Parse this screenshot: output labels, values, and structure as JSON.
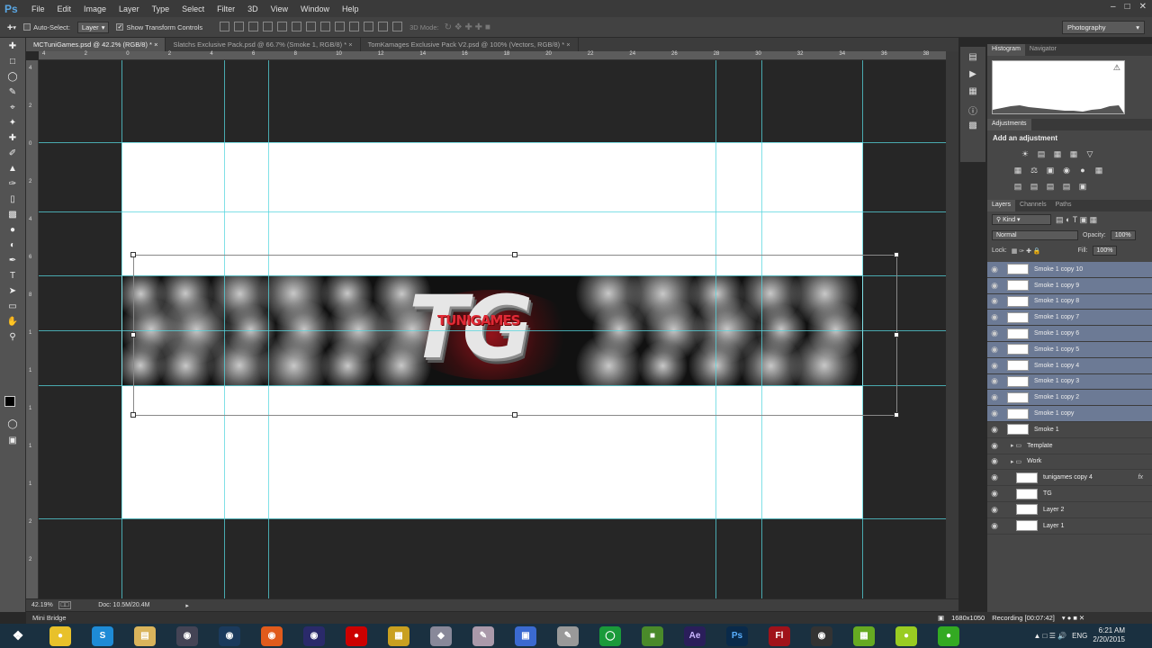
{
  "app": {
    "logo": "Ps",
    "menu": [
      "File",
      "Edit",
      "Image",
      "Layer",
      "Type",
      "Select",
      "Filter",
      "3D",
      "View",
      "Window",
      "Help"
    ]
  },
  "options": {
    "auto_select_label": "Auto-Select:",
    "auto_select_target": "Layer",
    "transform_label": "Show Transform Controls",
    "mode_3d": "3D Mode:",
    "workspace": "Photography"
  },
  "tabs": [
    "MCTuniGames.psd @ 42.2% (RGB/8) *",
    "Slatchs Exclusive Pack.psd @ 66.7% (Smoke 1, RGB/8) *",
    "TomKamages Exclusive Pack V2.psd @ 100% (Vectors, RGB/8) *"
  ],
  "ruler_top": [
    "4",
    "2",
    "0",
    "2",
    "4",
    "6",
    "8",
    "10",
    "12",
    "14",
    "16",
    "18",
    "20",
    "22",
    "24",
    "26",
    "28",
    "30",
    "32",
    "34",
    "36",
    "38"
  ],
  "ruler_left": [
    "4",
    "2",
    "0",
    "2",
    "4",
    "6",
    "8",
    "1",
    "1",
    "1",
    "1",
    "1",
    "2",
    "2"
  ],
  "banner": {
    "big_text": "TG",
    "word_text": "TUNIGAMES"
  },
  "status": {
    "zoom": "42.19%",
    "doc": "Doc: 10.5M/20.4M"
  },
  "mini_bridge": "Mini Bridge",
  "panels": {
    "top_tabs": [
      "Histogram",
      "Navigator"
    ],
    "adj_tabs": [
      "Adjustments"
    ],
    "adjust_title": "Add an adjustment",
    "layer_tabs": [
      "Layers",
      "Channels",
      "Paths"
    ],
    "kind": "Kind",
    "blend": "Normal",
    "opacity_label": "Opacity:",
    "opacity_value": "100%",
    "lock_label": "Lock:",
    "fill_label": "Fill:",
    "fill_value": "100%"
  },
  "layers": [
    {
      "name": "Smoke 1 copy 10",
      "selected": true
    },
    {
      "name": "Smoke 1 copy 9",
      "selected": true
    },
    {
      "name": "Smoke 1 copy 8",
      "selected": true
    },
    {
      "name": "Smoke 1 copy 7",
      "selected": true
    },
    {
      "name": "Smoke 1 copy 6",
      "selected": true
    },
    {
      "name": "Smoke 1 copy 5",
      "selected": true
    },
    {
      "name": "Smoke 1 copy 4",
      "selected": true
    },
    {
      "name": "Smoke 1 copy 3",
      "selected": true
    },
    {
      "name": "Smoke 1 copy 2",
      "selected": true
    },
    {
      "name": "Smoke 1 copy",
      "selected": true
    },
    {
      "name": "Smoke 1",
      "selected": false
    },
    {
      "name": "Template",
      "selected": false,
      "group": true
    },
    {
      "name": "Work",
      "selected": false,
      "group": true
    },
    {
      "name": "tunigames copy 4",
      "selected": false,
      "fx": true
    },
    {
      "name": "TG",
      "selected": false
    },
    {
      "name": "Layer 2",
      "selected": false
    },
    {
      "name": "Layer 1",
      "selected": false
    }
  ],
  "tray": {
    "resolution": "1680x1050",
    "recording": "Recording [00:07:42]",
    "lang": "ENG",
    "time": "6:21 AM",
    "date": "2/20/2015"
  },
  "colors": {
    "guide": "#55d6de",
    "selection": "#6c7a95",
    "tg_red": "#e02a36"
  }
}
